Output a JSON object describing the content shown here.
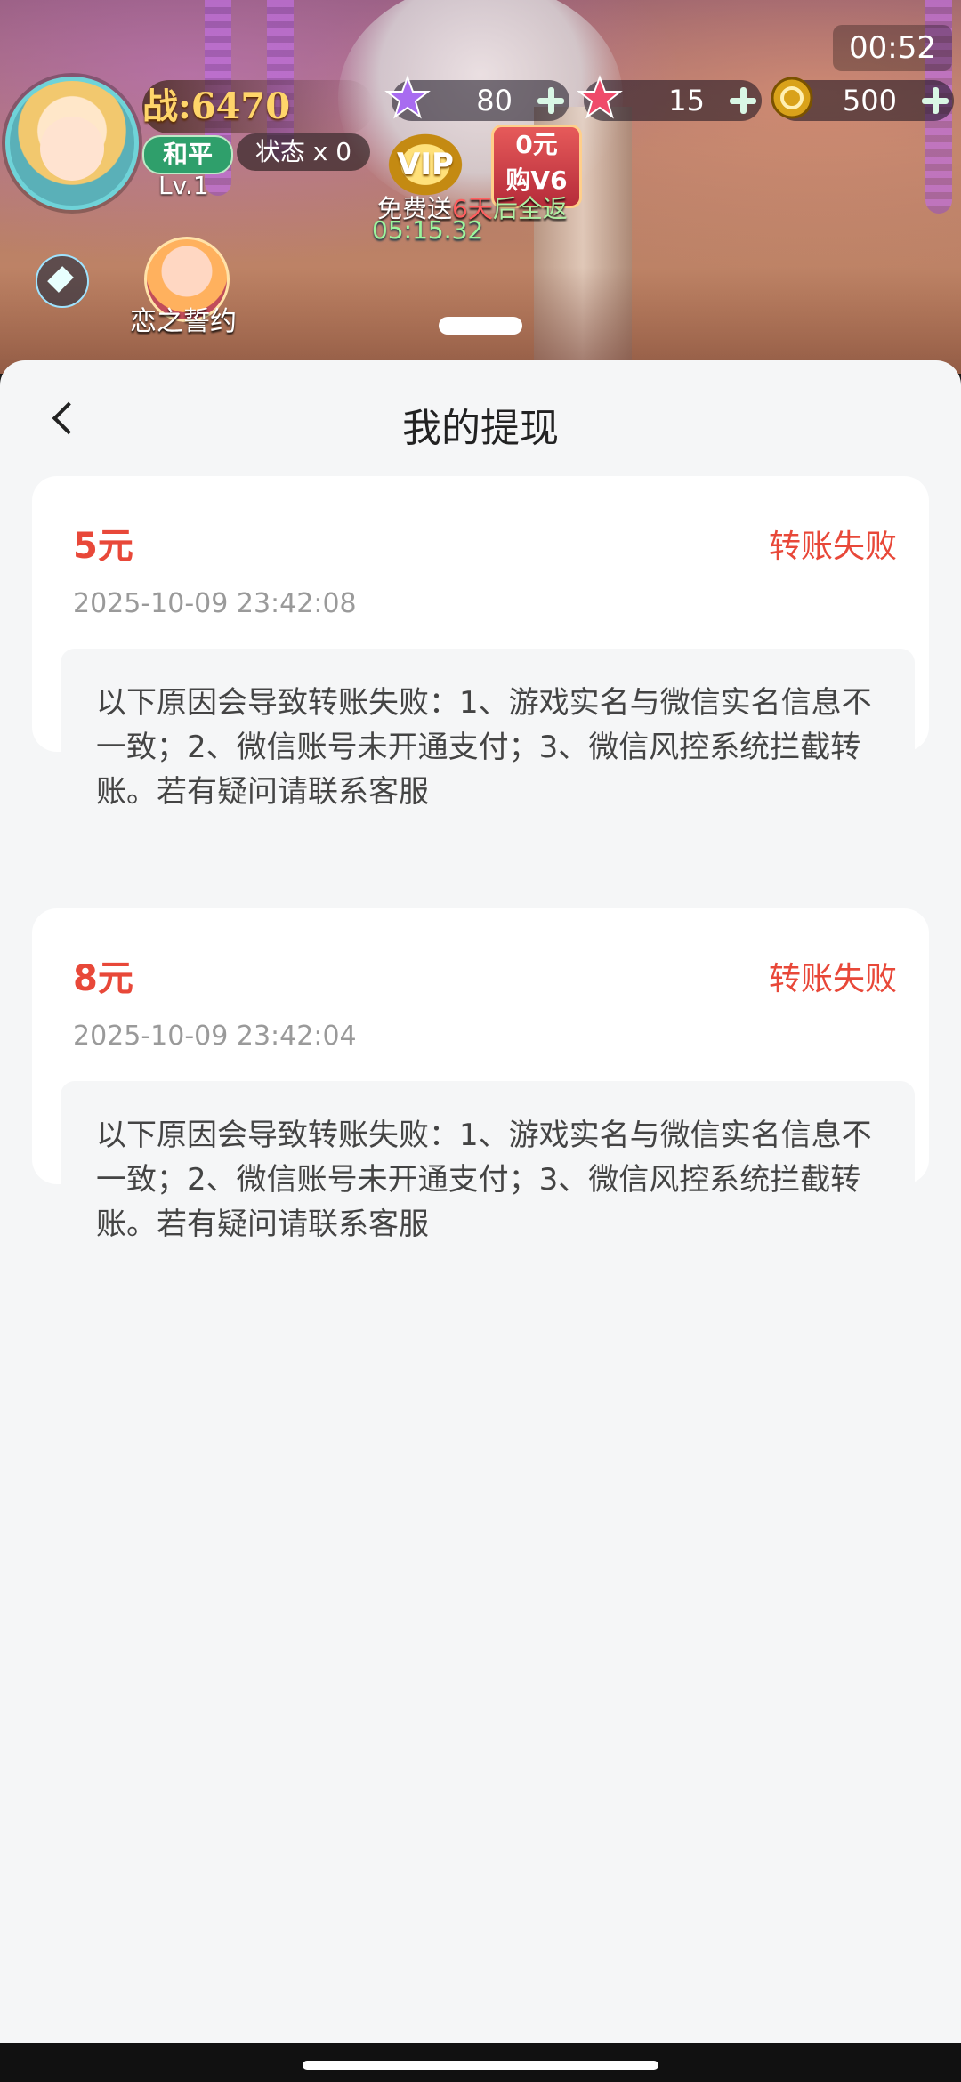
{
  "game": {
    "time": "00:52",
    "power": "战:6470",
    "peace_label": "和平",
    "state_label": "状态 x 0",
    "level": "Lv.1",
    "currencies": [
      {
        "icon": "purple-star-icon",
        "value": "80"
      },
      {
        "icon": "red-star-icon",
        "value": "15"
      },
      {
        "icon": "coin-icon",
        "value": "500"
      }
    ],
    "vip_label": "VIP",
    "zero_buy_lines": [
      "0元",
      "购V6"
    ],
    "free_send": "免费送",
    "free_days": "6天",
    "free_back": "后全返",
    "countdown": "05:15.32",
    "couple_label": "恋之誓约"
  },
  "sheet": {
    "title": "我的提现",
    "records": [
      {
        "amount": "5元",
        "status": "转账失败",
        "timestamp": "2025-10-09 23:42:08",
        "reason": "以下原因会导致转账失败：1、游戏实名与微信实名信息不一致；2、微信账号未开通支付；3、微信风控系统拦截转账。若有疑问请联系客服"
      },
      {
        "amount": "8元",
        "status": "转账失败",
        "timestamp": "2025-10-09 23:42:04",
        "reason": "以下原因会导致转账失败：1、游戏实名与微信实名信息不一致；2、微信账号未开通支付；3、微信风控系统拦截转账。若有疑问请联系客服"
      }
    ]
  },
  "colors": {
    "accent_red": "#e84839",
    "sheet_bg": "#f5f6f7",
    "card_bg": "#ffffff"
  }
}
